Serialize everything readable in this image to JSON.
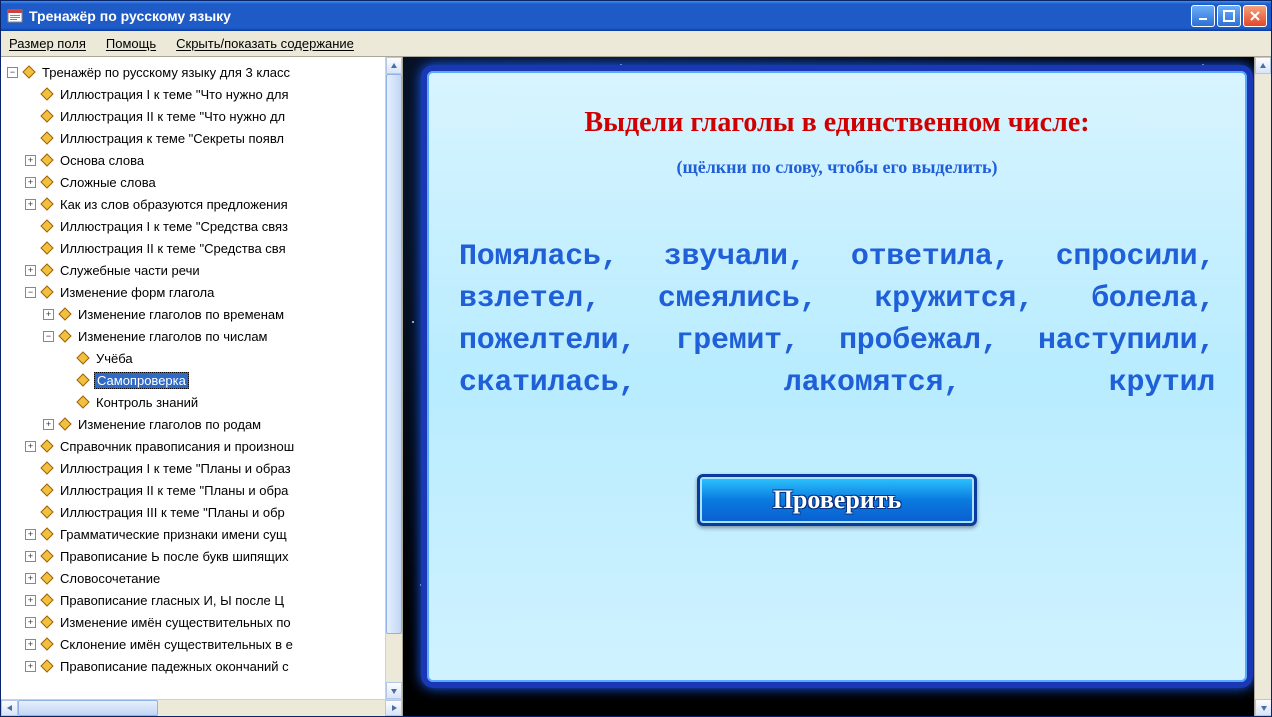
{
  "window": {
    "title": "Тренажёр по русскому языку"
  },
  "menu": {
    "field_size": "Размер поля",
    "help": "Помощь",
    "toggle_toc": "Скрыть/показать содержание"
  },
  "tree": {
    "root": "Тренажёр по русскому языку для 3 класс",
    "items": [
      "Иллюстрация I к теме \"Что нужно для",
      "Иллюстрация II к теме \"Что нужно дл",
      "Иллюстрация к теме \"Секреты появл",
      "Основа слова",
      "Сложные слова",
      "Как из слов образуются предложения",
      "Иллюстрация I к теме \"Средства связ",
      "Иллюстрация II к теме \"Средства свя",
      "Служебные части речи",
      "Изменение форм глагола",
      "Изменение глаголов по временам",
      "Изменение глаголов по числам",
      "Учёба",
      "Самопроверка",
      "Контроль знаний",
      "Изменение глаголов по родам",
      "Справочник правописания и произнош",
      "Иллюстрация I к теме \"Планы и образ",
      "Иллюстрация II к теме \"Планы и обра",
      "Иллюстрация III к теме \"Планы и обр",
      "Грамматические признаки имени сущ",
      "Правописание Ь после букв шипящих",
      "Словосочетание",
      "Правописание гласных И, Ы после Ц",
      "Изменение имён существительных по",
      "Склонение имён существительных в е",
      "Правописание падежных окончаний с"
    ]
  },
  "exercise": {
    "title": "Выдели глаголы в единственном числе:",
    "hint": "(щёлкни по слову, чтобы его выделить)",
    "words": [
      "Помялась",
      "звучали",
      "ответила",
      "спросили",
      "взлетел",
      "смеялись",
      "кружится",
      "болела",
      "пожелтели",
      "гремит",
      "пробежал",
      "наступили",
      "скатилась",
      "лакомятся",
      "крутил"
    ],
    "check_button": "Проверить"
  }
}
